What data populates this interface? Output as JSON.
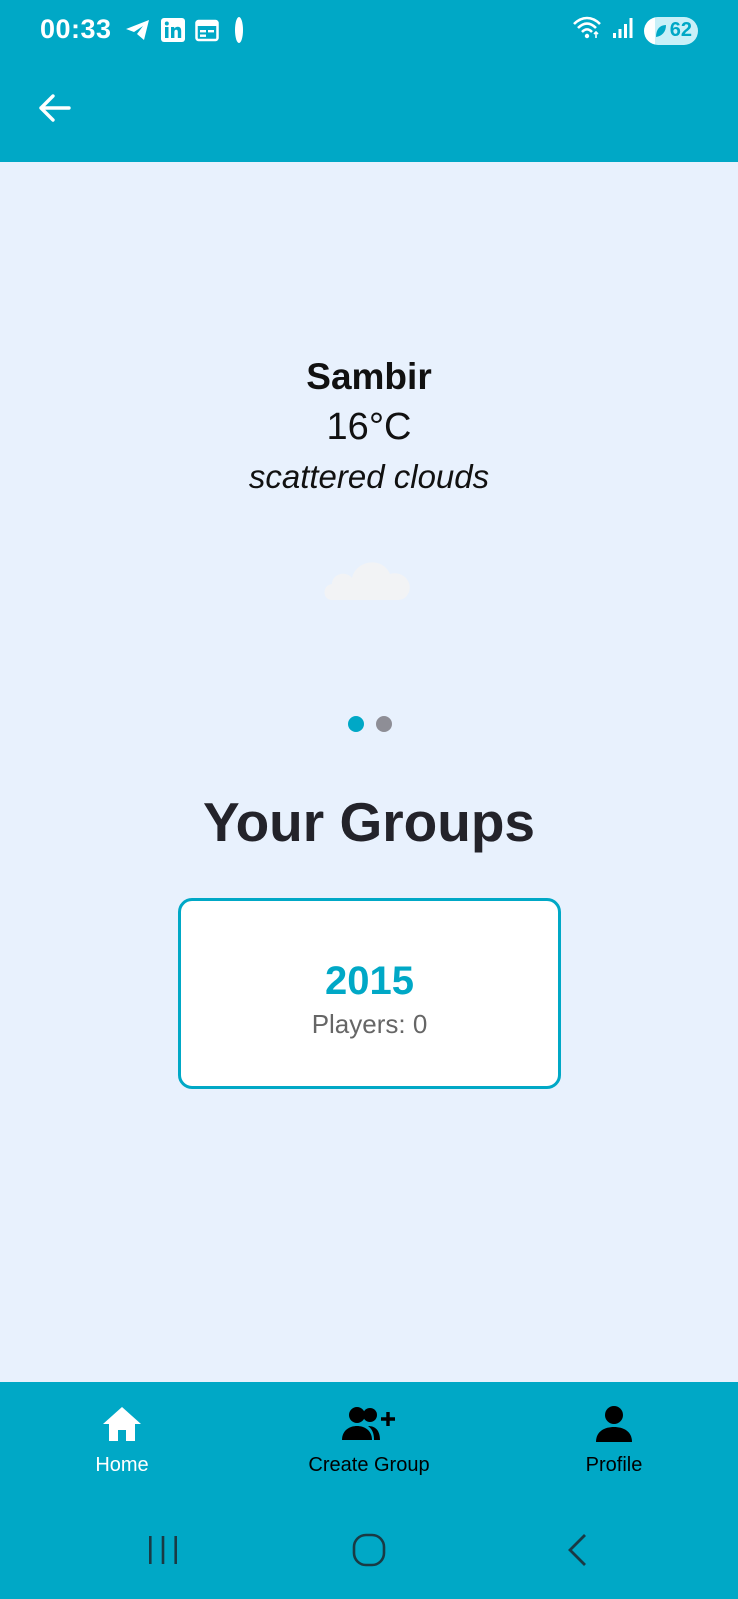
{
  "status_bar": {
    "time": "00:33",
    "battery": "62",
    "icons": [
      "telegram-icon",
      "linkedin-icon",
      "calendar-icon",
      "notification-dot",
      "wifi-icon",
      "signal-icon",
      "battery-icon"
    ]
  },
  "header": {
    "back_icon": "arrow-left-icon"
  },
  "weather": {
    "city": "Sambir",
    "temperature": "16°C",
    "description": "scattered clouds",
    "icon": "cloud-icon"
  },
  "carousel": {
    "pages": 2,
    "active_index": 0
  },
  "groups": {
    "title": "Your Groups",
    "items": [
      {
        "name": "2015",
        "players": "Players: 0"
      }
    ]
  },
  "bottom_nav": {
    "items": [
      {
        "label": "Home",
        "icon": "home-icon",
        "active": true
      },
      {
        "label": "Create Group",
        "icon": "add-group-icon",
        "active": false
      },
      {
        "label": "Profile",
        "icon": "person-icon",
        "active": false
      }
    ]
  },
  "system_nav": {
    "icons": [
      "recents-icon",
      "home-circle-icon",
      "back-chevron-icon"
    ]
  },
  "colors": {
    "accent": "#00a8c6",
    "background": "#e8f1fd",
    "card": "#ffffff",
    "dot_inactive": "#8e8e96"
  }
}
